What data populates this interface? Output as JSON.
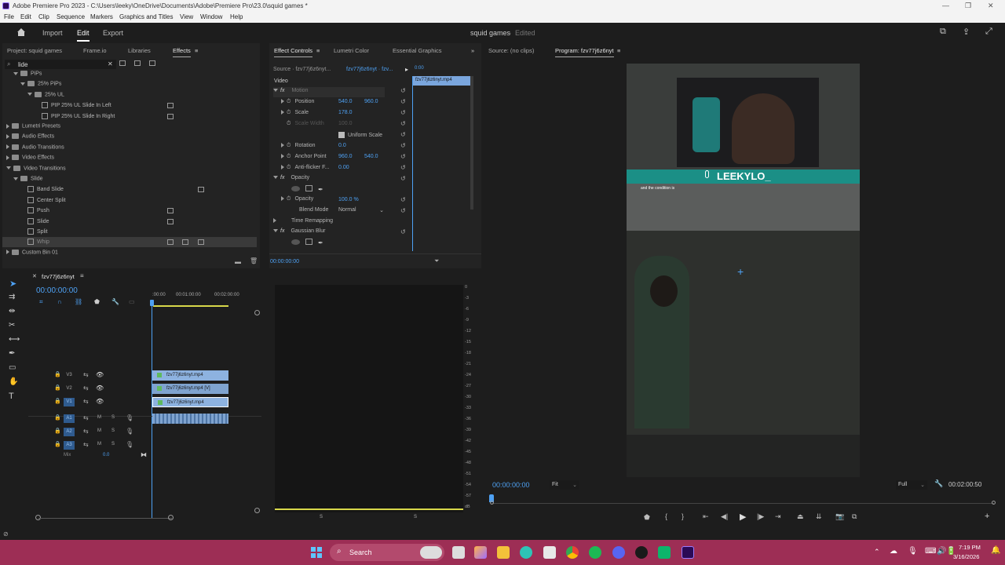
{
  "window": {
    "title": "Adobe Premiere Pro 2023 - C:\\Users\\leeky\\OneDrive\\Documents\\Adobe\\Premiere Pro\\23.0\\squid games *",
    "controls": [
      "—",
      "❐",
      "✕"
    ]
  },
  "menu": [
    "File",
    "Edit",
    "Clip",
    "Sequence",
    "Markers",
    "Graphics and Titles",
    "View",
    "Window",
    "Help"
  ],
  "header": {
    "tabs": [
      "Import",
      "Edit",
      "Export"
    ],
    "active_tab": "Edit",
    "project_name": "squid games",
    "status": "Edited"
  },
  "effects_panel": {
    "tabs": [
      "Project: squid games",
      "Frame.io",
      "Libraries",
      "Effects"
    ],
    "active_tab": "Effects",
    "search_value": "lide",
    "tree": [
      {
        "label": "PiPs",
        "indent": 1,
        "type": "folder",
        "open": true
      },
      {
        "label": "25% PiPs",
        "indent": 2,
        "type": "folder",
        "open": true
      },
      {
        "label": "25% UL",
        "indent": 3,
        "type": "folder",
        "open": true
      },
      {
        "label": "PIP 25% UL Slide In Left",
        "indent": 4,
        "type": "fx",
        "badges": 1
      },
      {
        "label": "PIP 25% UL Slide In Right",
        "indent": 4,
        "type": "fx",
        "badges": 1
      },
      {
        "label": "Lumetri Presets",
        "indent": 0,
        "type": "folder",
        "open": false
      },
      {
        "label": "Audio Effects",
        "indent": 0,
        "type": "folder",
        "open": false
      },
      {
        "label": "Audio Transitions",
        "indent": 0,
        "type": "folder",
        "open": false
      },
      {
        "label": "Video Effects",
        "indent": 0,
        "type": "folder",
        "open": false
      },
      {
        "label": "Video Transitions",
        "indent": 0,
        "type": "folder",
        "open": true
      },
      {
        "label": "Slide",
        "indent": 1,
        "type": "folder",
        "open": true
      },
      {
        "label": "Band Slide",
        "indent": 2,
        "type": "fx",
        "badges": 2
      },
      {
        "label": "Center Split",
        "indent": 2,
        "type": "fx",
        "badges": 0
      },
      {
        "label": "Push",
        "indent": 2,
        "type": "fx",
        "badges": 1
      },
      {
        "label": "Slide",
        "indent": 2,
        "type": "fx",
        "badges": 1
      },
      {
        "label": "Split",
        "indent": 2,
        "type": "fx",
        "badges": 0
      },
      {
        "label": "Whip",
        "indent": 2,
        "type": "fx",
        "badges": 3,
        "selected": true
      },
      {
        "label": "Custom Bin 01",
        "indent": 0,
        "type": "folder",
        "open": false
      }
    ]
  },
  "effect_controls": {
    "tabs": [
      "Effect Controls",
      "Lumetri Color",
      "Essential Graphics"
    ],
    "active_tab": "Effect Controls",
    "source_label": "Source · fzv77j6z6nyt...",
    "sequence_label": "fzv77j6z6nyt · fzv...",
    "clip_chip": "fzv77j6z6nyt.mp4",
    "section_video": "Video",
    "motion": "Motion",
    "params": [
      {
        "name": "Position",
        "v1": "540.0",
        "v2": "960.0"
      },
      {
        "name": "Scale",
        "v1": "178.0"
      },
      {
        "name": "Scale Width",
        "v1": "100.0",
        "disabled": true
      },
      {
        "name": "Uniform Scale",
        "checkbox": true
      },
      {
        "name": "Rotation",
        "v1": "0.0"
      },
      {
        "name": "Anchor Point",
        "v1": "960.0",
        "v2": "540.0"
      },
      {
        "name": "Anti-flicker F...",
        "v1": "0.00"
      }
    ],
    "opacity_section": "Opacity",
    "opacity_value": "100.0 %",
    "opacity_label": "Opacity",
    "blend_label": "Blend Mode",
    "blend_value": "Normal",
    "time_remap": "Time Remapping",
    "gaussian": "Gaussian Blur",
    "timecode": "00:00:00:00",
    "timeline_marker": "0:00"
  },
  "source_monitor": {
    "label": "Source: (no clips)"
  },
  "program_monitor": {
    "label": "Program: fzv77j6z6nyt",
    "timecode": "00:00:00:00",
    "fit": "Fit",
    "quality": "Full",
    "duration": "00:02:00:50",
    "overlay_handle": "LEEKYLO_",
    "caption": "and the condition is"
  },
  "timeline": {
    "sequence_name": "fzv77j6z6nyt",
    "timecode": "00:00:00:00",
    "ruler": [
      ":00:00",
      "00:01:00:00",
      "00:02:00:00"
    ],
    "tracks_video": [
      "V3",
      "V2",
      "V1"
    ],
    "tracks_audio": [
      "A1",
      "A2",
      "A3"
    ],
    "clips": [
      {
        "track": "V3",
        "label": "fzv77j6z6nyt.mp4"
      },
      {
        "track": "V2",
        "label": "fzv77j6z6nyt.mp4 [V]"
      },
      {
        "track": "V1",
        "label": "fzv77j6z6nyt.mp4"
      }
    ],
    "mix_label": "Mix",
    "mix_value": "0.0"
  },
  "audio_meter": {
    "scale": [
      "0",
      "-3",
      "-6",
      "-9",
      "-12",
      "-15",
      "-18",
      "-21",
      "-24",
      "-27",
      "-30",
      "-33",
      "-36",
      "-39",
      "-42",
      "-45",
      "-48",
      "-51",
      "-54",
      "-57",
      "dB"
    ],
    "channels": [
      "S",
      "S"
    ]
  },
  "taskbar": {
    "search_placeholder": "Search",
    "time": "7:19 PM",
    "date": "3/16/2026"
  }
}
